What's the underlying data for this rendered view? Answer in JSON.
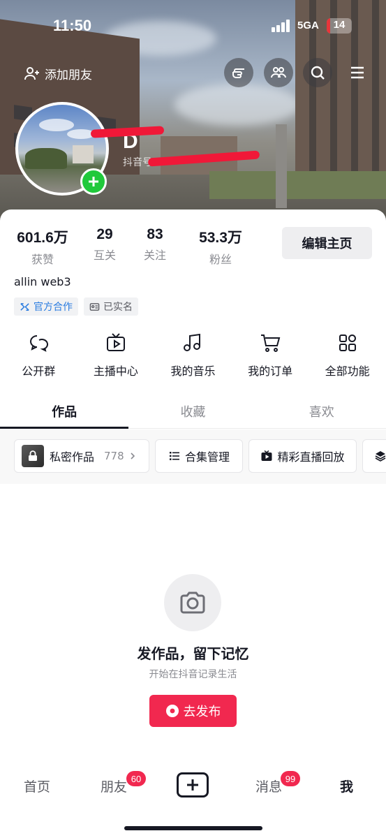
{
  "status_bar": {
    "time": "11:50",
    "network": "5GA",
    "battery": "14",
    "battery_level": 0.14
  },
  "header": {
    "add_friend_label": "添加朋友",
    "nickname": "D",
    "account_id_prefix": "抖音号"
  },
  "stats": [
    {
      "value": "601.6万",
      "label": "获赞"
    },
    {
      "value": "29",
      "label": "互关"
    },
    {
      "value": "83",
      "label": "关注"
    },
    {
      "value": "53.3万",
      "label": "粉丝"
    }
  ],
  "edit_profile_label": "编辑主页",
  "bio": "allin web3",
  "tags": {
    "official": "官方合作",
    "verified": "已实名"
  },
  "features": [
    {
      "label": "公开群",
      "icon": "chat-bubbles-icon"
    },
    {
      "label": "主播中心",
      "icon": "tv-play-icon"
    },
    {
      "label": "我的音乐",
      "icon": "music-note-icon"
    },
    {
      "label": "我的订单",
      "icon": "cart-icon"
    },
    {
      "label": "全部功能",
      "icon": "grid-icon"
    }
  ],
  "tabs": [
    "作品",
    "收藏",
    "喜欢"
  ],
  "chips": {
    "private_label": "私密作品",
    "private_count": "778",
    "collection_label": "合集管理",
    "live_replay_label": "精彩直播回放"
  },
  "empty_state": {
    "title": "发作品，留下记忆",
    "subtitle": "开始在抖音记录生活",
    "button_label": "去发布"
  },
  "bottom_nav": {
    "home": "首页",
    "friends": "朋友",
    "friends_badge": "60",
    "messages": "消息",
    "messages_badge": "99",
    "me": "我"
  },
  "colors": {
    "accent": "#f1284f",
    "online_green": "#20c93b",
    "link_blue": "#2a7ce0"
  }
}
